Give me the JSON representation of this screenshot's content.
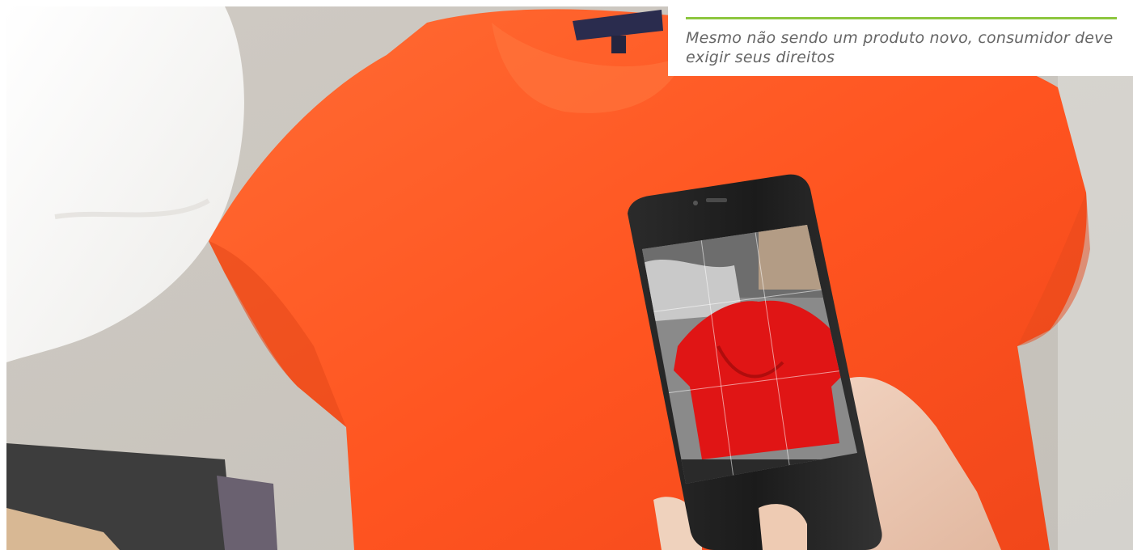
{
  "caption": {
    "text": "Mesmo não sendo um produto novo, consumidor deve exigir seus direitos",
    "rule_color": "#8dc63f",
    "text_color": "#666666"
  },
  "photo": {
    "shirt_color": "#ff5a22",
    "phone_screen_shirt_color": "#e01515"
  }
}
